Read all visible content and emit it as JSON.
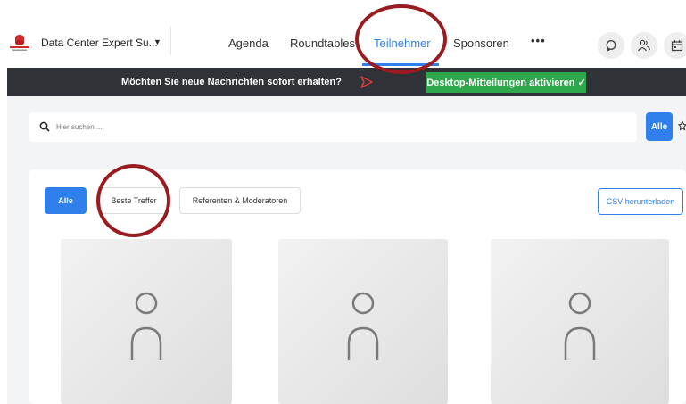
{
  "header": {
    "event_name": "Data Center Expert Su...",
    "nav": [
      "Agenda",
      "Roundtables",
      "Teilnehmer",
      "Sponsoren"
    ],
    "active_nav": "Teilnehmer",
    "more_label": "•••",
    "icons": [
      "chat-icon",
      "people-icon",
      "calendar-icon"
    ]
  },
  "banner": {
    "text": "Möchten Sie neue Nachrichten sofort erhalten?",
    "button_label": "Desktop-Mitteilungen aktivieren ✓"
  },
  "search": {
    "placeholder": "Hier suchen ...",
    "filter_label": "Alle"
  },
  "tabs": [
    {
      "label": "Alle",
      "active": true
    },
    {
      "label": "Beste Treffer",
      "active": false
    },
    {
      "label": "Referenten & Moderatoren",
      "active": false
    }
  ],
  "csv_button": "CSV herunterladen",
  "colors": {
    "accent": "#2f80ed",
    "banner_bg": "#2f3237",
    "banner_button": "#2ea84b",
    "annotation": "#9b1c20"
  }
}
